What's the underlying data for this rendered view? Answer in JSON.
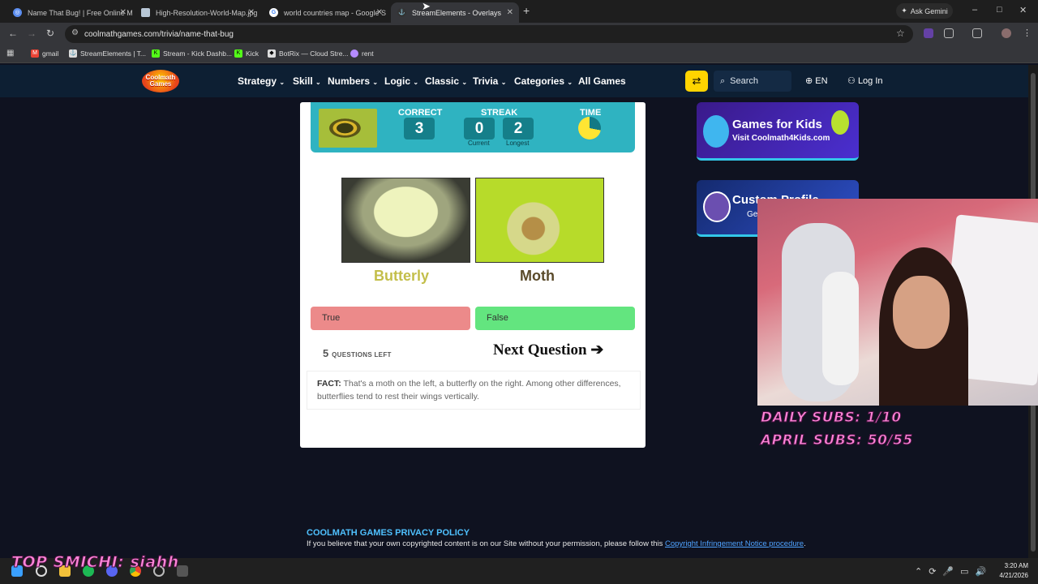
{
  "browser": {
    "tabs": [
      {
        "title": "Name That Bug! | Free Online M",
        "icon": "coolmath-icon",
        "color": "#5b8def"
      },
      {
        "title": "High-Resolution-World-Map.jpg",
        "icon": "image-icon",
        "color": "#b8c7d6"
      },
      {
        "title": "world countries map - Google S",
        "icon": "google-icon",
        "color": "#ffffff"
      },
      {
        "title": "StreamElements - Overlays",
        "icon": "streamelements-icon",
        "color": "#333333",
        "active": true
      }
    ],
    "new_tab": "+",
    "ask_gemini": "Ask Gemini",
    "window_controls": [
      "–",
      "□",
      "✕"
    ],
    "url": "coolmathgames.com/trivia/name-that-bug",
    "bookmarks": [
      {
        "label": "gmail",
        "icon": "gmail-icon"
      },
      {
        "label": "StreamElements | T...",
        "icon": "streamelements-icon"
      },
      {
        "label": "Stream - Kick Dashb...",
        "icon": "kick-icon"
      },
      {
        "label": "Kick",
        "icon": "kick-icon"
      },
      {
        "label": "BotRix — Cloud Stre...",
        "icon": "botrix-icon"
      },
      {
        "label": "rent",
        "icon": "rent-icon"
      }
    ]
  },
  "site": {
    "logo": "Coolmath Games",
    "nav": [
      "Strategy",
      "Skill",
      "Numbers",
      "Logic",
      "Classic",
      "Trivia",
      "Categories",
      "All Games"
    ],
    "search_placeholder": "Search",
    "language": "EN",
    "login": "Log In"
  },
  "quiz": {
    "correct_label": "CORRECT",
    "correct_value": "3",
    "streak_label": "STREAK",
    "current_value": "0",
    "current_label": "Current",
    "longest_value": "2",
    "longest_label": "Longest",
    "time_label": "TIME",
    "time_elapsed_fraction": 0.28,
    "left_label": "Butterly",
    "right_label": "Moth",
    "true_label": "True",
    "false_label": "False",
    "questions_left_count": "5",
    "questions_left_label": "QUESTIONS LEFT",
    "next_label": "Next Question",
    "fact_label": "FACT:",
    "fact_text": "That's a moth on the left, a butterfly on the right. Among other differences, butterflies tend to rest their wings vertically."
  },
  "ads": {
    "kids_title": "Games for Kids",
    "kids_sub": "Visit Coolmath4Kids.com",
    "profile_title": "Custom Profile",
    "profile_sub": "Ge"
  },
  "overlay": {
    "daily_subs": "DAILY SUBS: 1/10",
    "april_subs": "APRIL SUBS: 50/55",
    "top_smichi": "TOP SMICHI: siahh"
  },
  "footer": {
    "privacy_title": "COOLMATH GAMES PRIVACY POLICY",
    "privacy_text": "If you believe that your own copyrighted content is on our Site without your permission, please follow this",
    "privacy_link": "Copyright Infringement Notice procedure",
    "privacy_end": "."
  },
  "taskbar": {
    "time": "3:20 AM",
    "date": "4/21/2026"
  }
}
